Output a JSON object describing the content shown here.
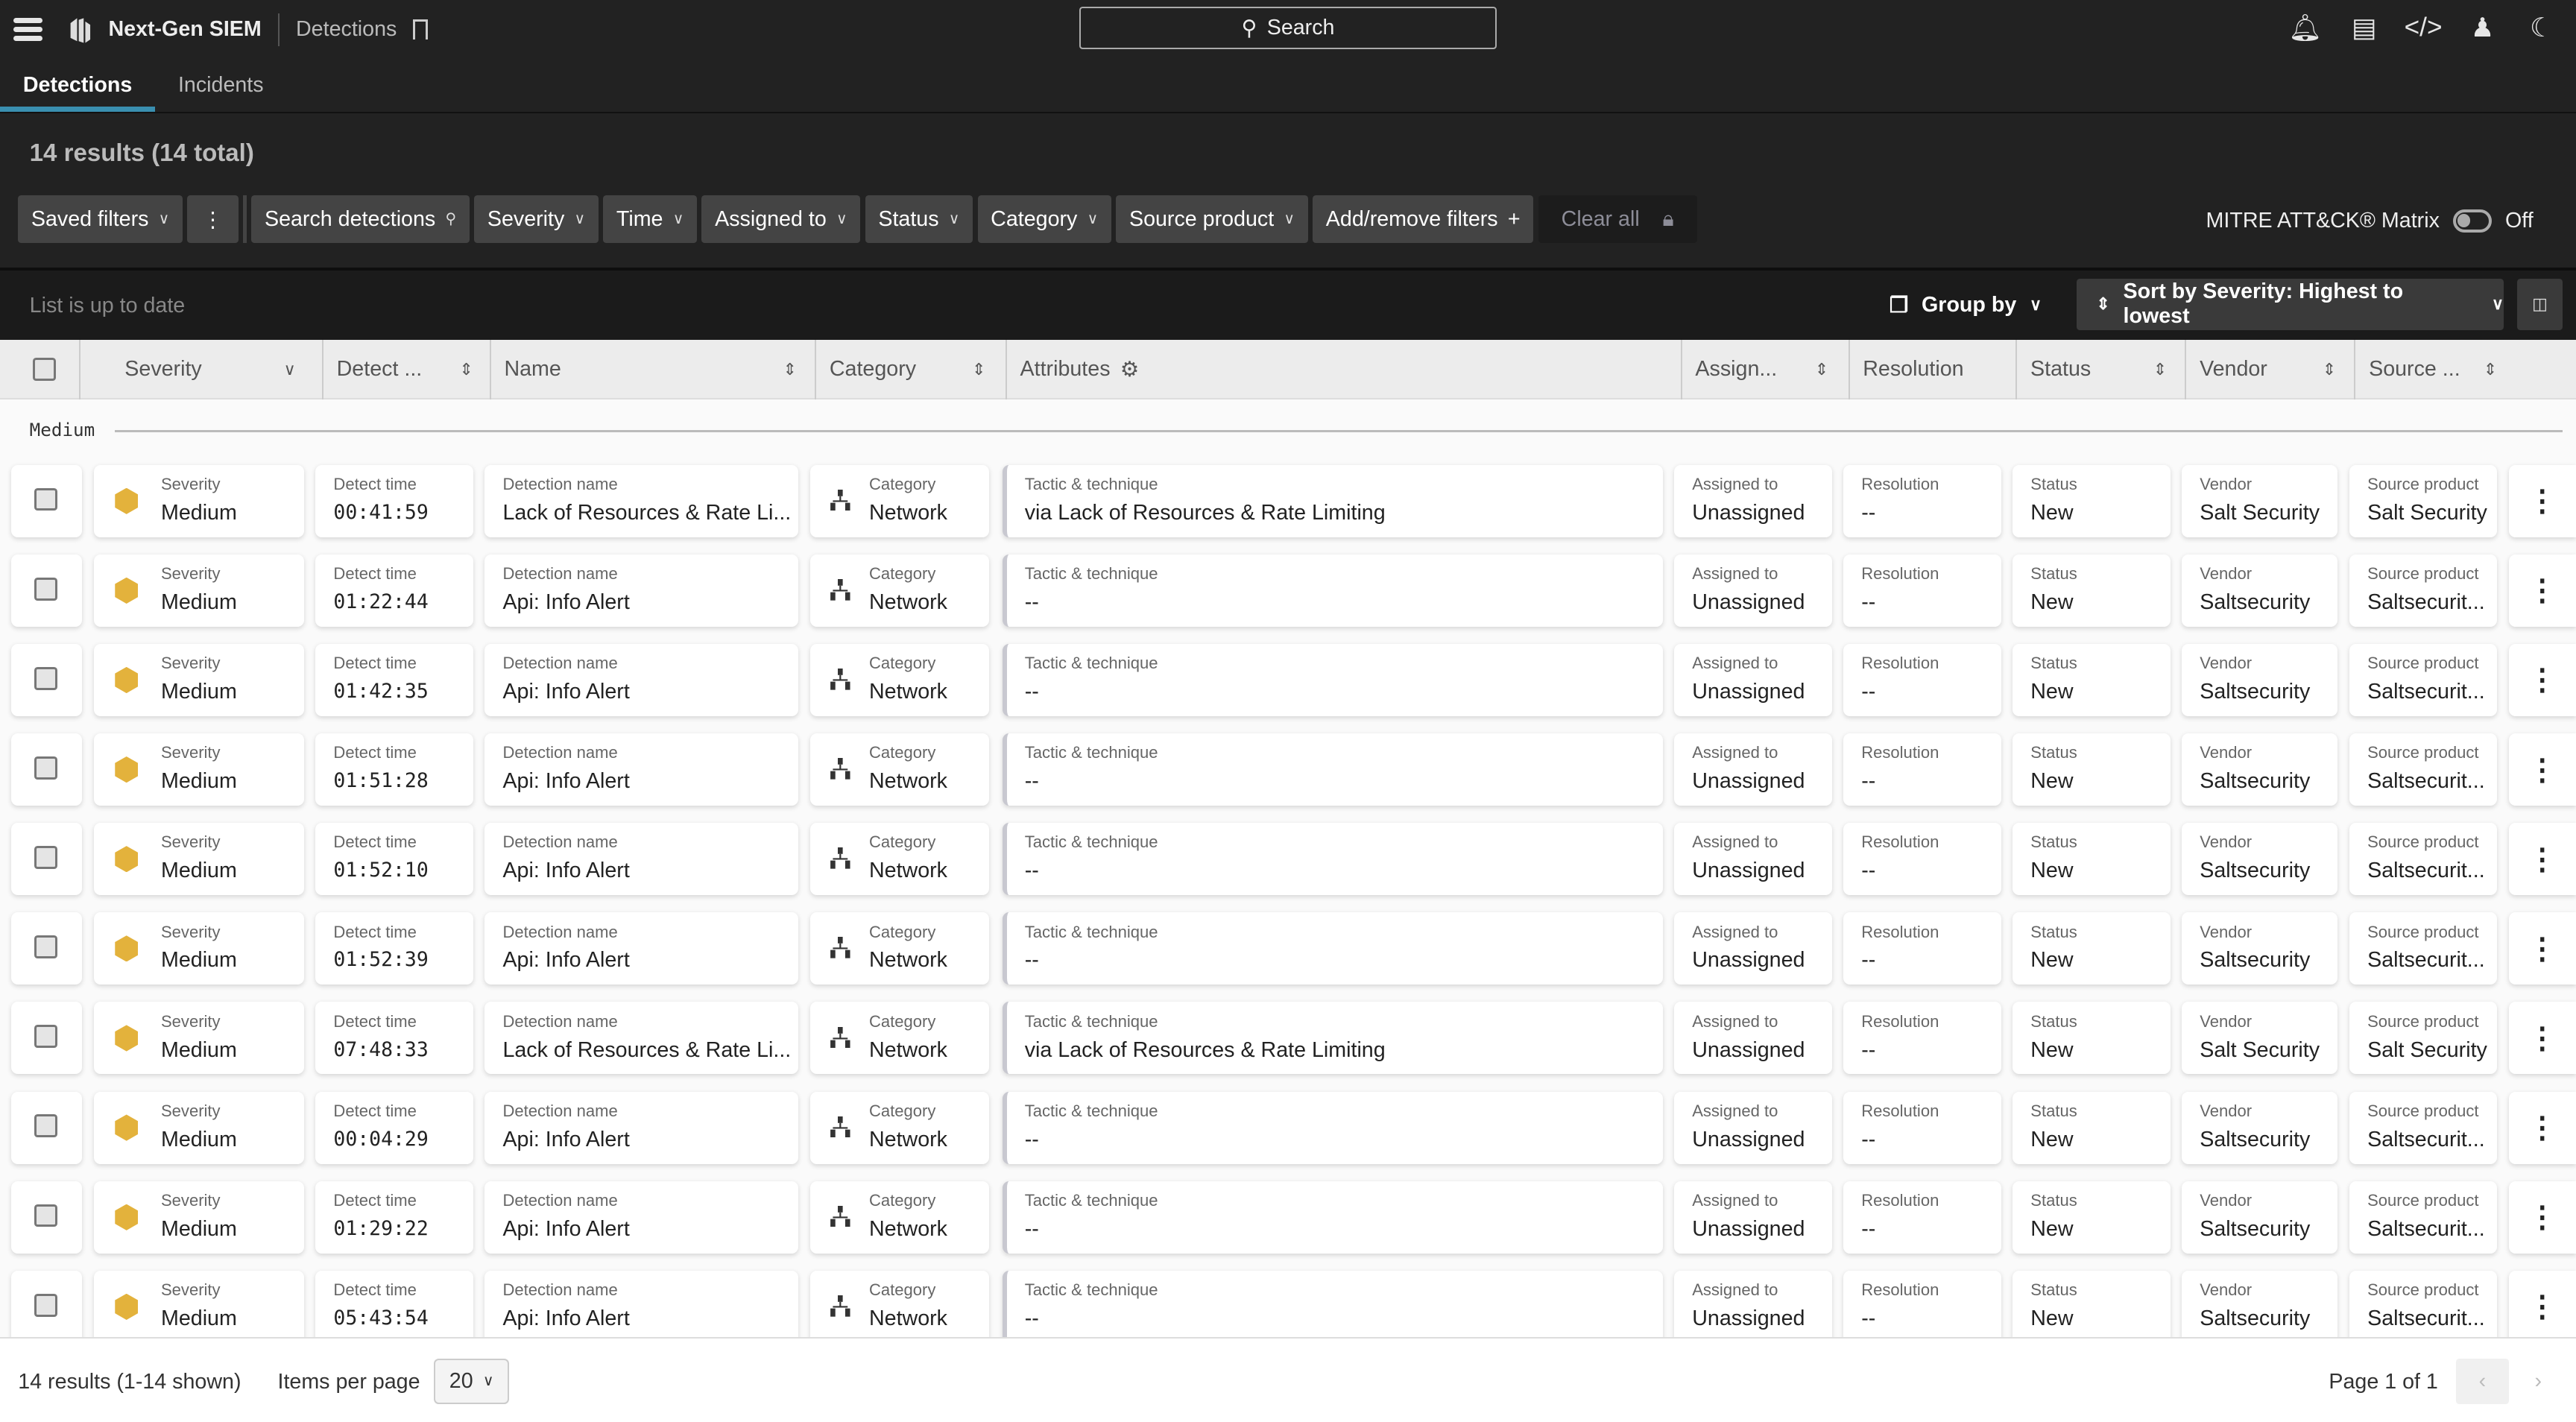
{
  "app": {
    "title": "Next-Gen SIEM",
    "breadcrumb": "Detections",
    "search_label": "Search"
  },
  "tabs": [
    {
      "label": "Detections",
      "active": true
    },
    {
      "label": "Incidents",
      "active": false
    }
  ],
  "results_count": "14 results (14 total)",
  "filters": {
    "saved": "Saved filters",
    "search": "Search detections",
    "items": [
      "Severity",
      "Time",
      "Assigned to",
      "Status",
      "Category",
      "Source product"
    ],
    "add": "Add/remove filters",
    "clear": "Clear all"
  },
  "mitre": {
    "label": "MITRE ATT&CK® Matrix",
    "state": "Off"
  },
  "list_status": "List is up to date",
  "group_by": "Group by",
  "sort": "Sort by Severity: Highest to lowest",
  "columns": [
    "Severity",
    "Detect ...",
    "Name",
    "Category",
    "Attributes",
    "Assign...",
    "Resolution",
    "Status",
    "Vendor",
    "Source ..."
  ],
  "group_label": "Medium",
  "field_labels": {
    "severity": "Severity",
    "time": "Detect time",
    "name": "Detection name",
    "category": "Category",
    "tactic": "Tactic & technique",
    "assigned": "Assigned to",
    "resolution": "Resolution",
    "status": "Status",
    "vendor": "Vendor",
    "source": "Source product"
  },
  "severity_color": "#e3b23c",
  "rows": [
    {
      "severity": "Medium",
      "time": "00:41:59",
      "name": "Lack of Resources & Rate Li...",
      "category": "Network",
      "tactic": "via Lack of Resources & Rate Limiting",
      "assigned": "Unassigned",
      "resolution": "--",
      "status": "New",
      "vendor": "Salt Security",
      "source": "Salt Security"
    },
    {
      "severity": "Medium",
      "time": "01:22:44",
      "name": "Api: Info Alert",
      "category": "Network",
      "tactic": "--",
      "assigned": "Unassigned",
      "resolution": "--",
      "status": "New",
      "vendor": "Saltsecurity",
      "source": "Saltsecurit..."
    },
    {
      "severity": "Medium",
      "time": "01:42:35",
      "name": "Api: Info Alert",
      "category": "Network",
      "tactic": "--",
      "assigned": "Unassigned",
      "resolution": "--",
      "status": "New",
      "vendor": "Saltsecurity",
      "source": "Saltsecurit..."
    },
    {
      "severity": "Medium",
      "time": "01:51:28",
      "name": "Api: Info Alert",
      "category": "Network",
      "tactic": "--",
      "assigned": "Unassigned",
      "resolution": "--",
      "status": "New",
      "vendor": "Saltsecurity",
      "source": "Saltsecurit..."
    },
    {
      "severity": "Medium",
      "time": "01:52:10",
      "name": "Api: Info Alert",
      "category": "Network",
      "tactic": "--",
      "assigned": "Unassigned",
      "resolution": "--",
      "status": "New",
      "vendor": "Saltsecurity",
      "source": "Saltsecurit..."
    },
    {
      "severity": "Medium",
      "time": "01:52:39",
      "name": "Api: Info Alert",
      "category": "Network",
      "tactic": "--",
      "assigned": "Unassigned",
      "resolution": "--",
      "status": "New",
      "vendor": "Saltsecurity",
      "source": "Saltsecurit..."
    },
    {
      "severity": "Medium",
      "time": "07:48:33",
      "name": "Lack of Resources & Rate Li...",
      "category": "Network",
      "tactic": "via Lack of Resources & Rate Limiting",
      "assigned": "Unassigned",
      "resolution": "--",
      "status": "New",
      "vendor": "Salt Security",
      "source": "Salt Security"
    },
    {
      "severity": "Medium",
      "time": "00:04:29",
      "name": "Api: Info Alert",
      "category": "Network",
      "tactic": "--",
      "assigned": "Unassigned",
      "resolution": "--",
      "status": "New",
      "vendor": "Saltsecurity",
      "source": "Saltsecurit..."
    },
    {
      "severity": "Medium",
      "time": "01:29:22",
      "name": "Api: Info Alert",
      "category": "Network",
      "tactic": "--",
      "assigned": "Unassigned",
      "resolution": "--",
      "status": "New",
      "vendor": "Saltsecurity",
      "source": "Saltsecurit..."
    },
    {
      "severity": "Medium",
      "time": "05:43:54",
      "name": "Api: Info Alert",
      "category": "Network",
      "tactic": "--",
      "assigned": "Unassigned",
      "resolution": "--",
      "status": "New",
      "vendor": "Saltsecurity",
      "source": "Saltsecurit..."
    }
  ],
  "footer": {
    "shown": "14 results (1-14 shown)",
    "per_page_label": "Items per page",
    "per_page": "20",
    "page": "Page 1 of 1"
  }
}
